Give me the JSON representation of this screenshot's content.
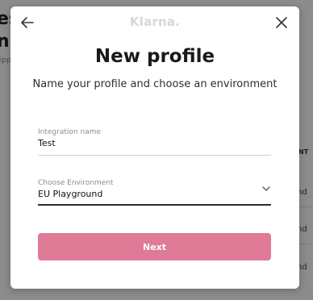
{
  "background": {
    "title_fragment_1": "es",
    "title_fragment_2": "n",
    "subtitle_fragment": "ipp",
    "column_header_fragment": "NT",
    "row_values": [
      "nd",
      "nd",
      "nd"
    ]
  },
  "modal": {
    "logo": "Klarna.",
    "title": "New profile",
    "subtitle": "Name your profile and choose an environment",
    "integration_name": {
      "label": "Integration name",
      "value": "Test"
    },
    "environment": {
      "label": "Choose Environment",
      "value": "EU Playground"
    },
    "next_label": "Next"
  },
  "colors": {
    "accent_button": "#df7a97",
    "overlay": "rgba(0,0,0,0.45)"
  },
  "icons": {
    "back": "arrow-left-icon",
    "close": "close-icon",
    "dropdown": "chevron-down-icon"
  }
}
